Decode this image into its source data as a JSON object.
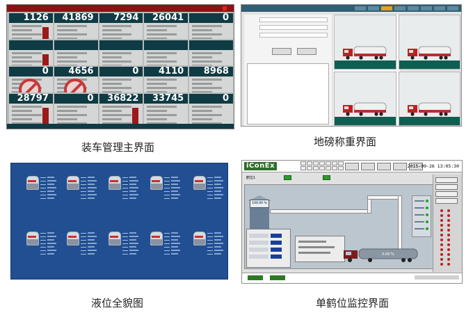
{
  "panels": {
    "loading": {
      "caption": "装车管理主界面",
      "bays": [
        "1126",
        "41869",
        "7294",
        "26041",
        "0",
        "",
        "",
        "",
        "",
        "",
        "0",
        "4656",
        "0",
        "4110",
        "8968",
        "28797",
        "0",
        "36822",
        "33745",
        "0"
      ]
    },
    "weighbridge": {
      "caption": "地磅称重界面"
    },
    "tanks": {
      "caption": "液位全貌图"
    },
    "crane": {
      "caption": "单鹤位监控界面",
      "logo": "iConEx",
      "datetime": "2015-09-26 13:05:30",
      "tank_fill_pct": "100.00 %",
      "truck_fill_pct": "0.00 %",
      "bay_label": "鹤位1"
    }
  },
  "colors": {
    "loading_title": "#8c1212",
    "bay_header": "#0f3b44",
    "tank_bg": "#214f92",
    "ground": "#0f5e52",
    "logo": "#2f6e2a",
    "alarm": "#c21e1e"
  }
}
